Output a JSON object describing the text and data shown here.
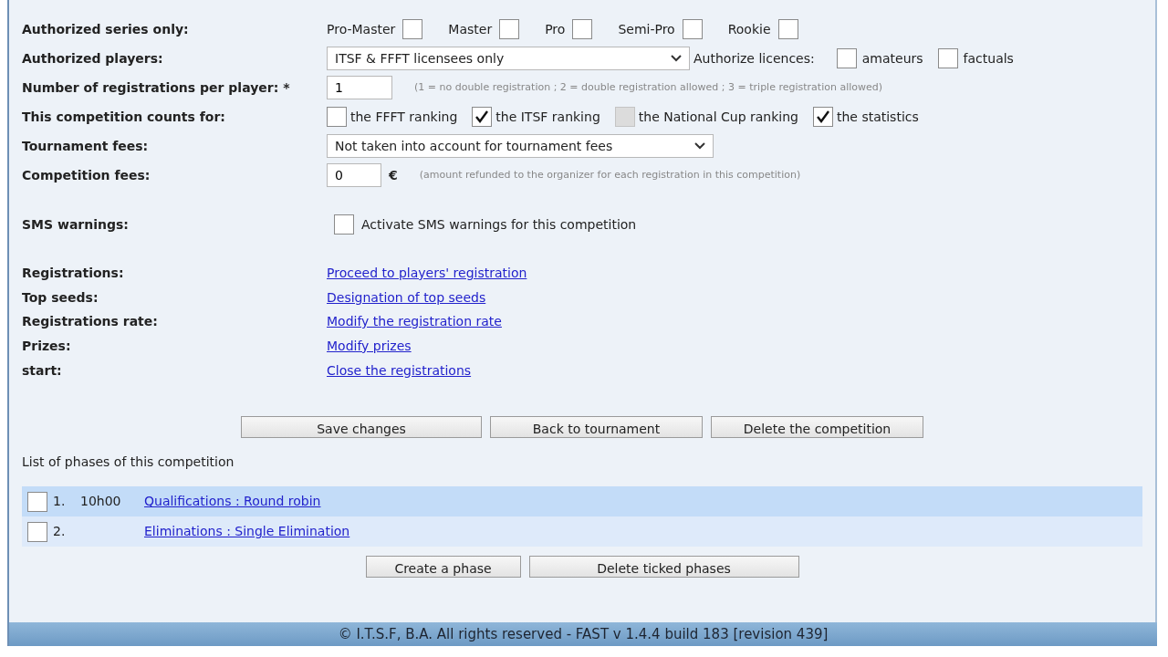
{
  "settings": [
    {
      "kind": "series",
      "label": "Authorized series only:",
      "options": [
        {
          "label": "Pro-Master",
          "checked": false
        },
        {
          "label": "Master",
          "checked": false
        },
        {
          "label": "Pro",
          "checked": false
        },
        {
          "label": "Semi-Pro",
          "checked": false
        },
        {
          "label": "Rookie",
          "checked": false
        }
      ]
    },
    {
      "kind": "players",
      "label": "Authorized players:",
      "value": "ITSF & FFFT licensees only",
      "extra_label": "Authorize licences:",
      "options": [
        {
          "label": "amateurs",
          "checked": false
        },
        {
          "label": "factuals",
          "checked": false
        }
      ]
    },
    {
      "kind": "number",
      "label": "Number of registrations per player: *",
      "value": "1",
      "hint": "(1 = no double registration ; 2 = double registration allowed ; 3 = triple registration allowed)"
    },
    {
      "kind": "counts",
      "label": "This competition counts for:",
      "options": [
        {
          "label": "the FFFT ranking",
          "checked": false,
          "disabled": false
        },
        {
          "label": "the ITSF ranking",
          "checked": true,
          "disabled": false
        },
        {
          "label": "the National Cup ranking",
          "checked": false,
          "disabled": true
        },
        {
          "label": "the statistics",
          "checked": true,
          "disabled": false
        }
      ]
    },
    {
      "kind": "select",
      "label": "Tournament fees:",
      "value": "Not taken into account for tournament fees"
    },
    {
      "kind": "fee",
      "label": "Competition fees:",
      "value": "0",
      "unit": "€",
      "hint": "(amount refunded to the organizer for each registration in this competition)"
    }
  ],
  "sms": {
    "label": "SMS warnings:",
    "option": "Activate SMS warnings for this competition",
    "checked": false
  },
  "actions": [
    {
      "label": "Registrations:",
      "link": "Proceed to players' registration"
    },
    {
      "label": "Top seeds:",
      "link": "Designation of top seeds"
    },
    {
      "label": "Registrations rate:",
      "link": "Modify the registration rate"
    },
    {
      "label": "Prizes:",
      "link": "Modify prizes"
    },
    {
      "label": "start:",
      "link": "Close the registrations"
    }
  ],
  "buttons": [
    "Save changes",
    "Back to tournament",
    "Delete the competition"
  ],
  "phases": {
    "title": "List of phases of this competition",
    "items": [
      {
        "number": "1.",
        "time": "10h00",
        "link": "Qualifications : Round robin",
        "checked": false,
        "highlighted": true
      },
      {
        "number": "2.",
        "link": "Eliminations : Single Elimination",
        "checked": false,
        "highlighted": false
      }
    ]
  },
  "phase_buttons": [
    "Create a phase",
    "Delete ticked phases"
  ],
  "footer": "© I.T.S.F, B.A. All rights reserved - FAST v 1.4.4 build 183 [revision 439]"
}
